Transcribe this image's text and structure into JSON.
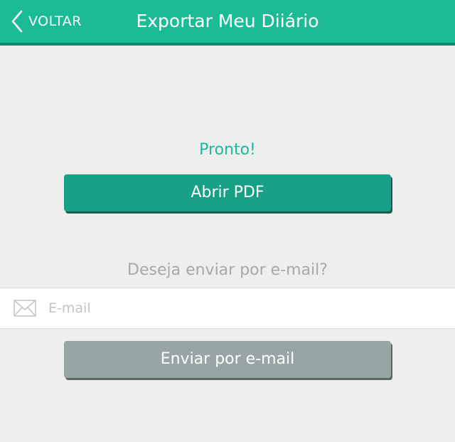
{
  "header": {
    "back_label": "VOLTAR",
    "title": "Exportar Meu Diiário",
    "back_icon": "chevron-left-icon"
  },
  "export": {
    "status": "Pronto!",
    "open_pdf_label": "Abrir PDF"
  },
  "email": {
    "question": "Deseja enviar por e-mail?",
    "icon": "envelope-icon",
    "input_placeholder": "E-mail",
    "input_value": "",
    "send_label": "Enviar por e-mail"
  },
  "colors": {
    "accent": "#1cbb98",
    "accent_dark": "#17a085",
    "disabled_button": "#97a6a4",
    "background": "#eeeeee"
  }
}
